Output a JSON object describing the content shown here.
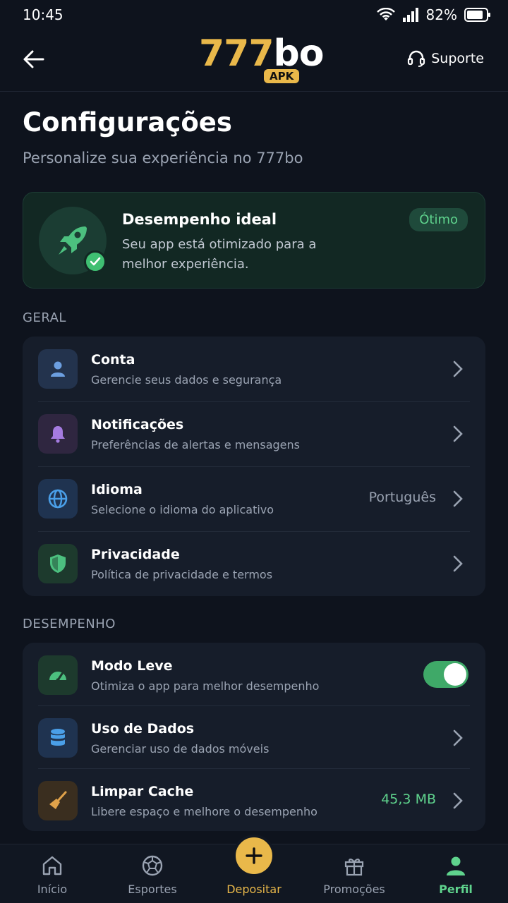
{
  "status_bar": {
    "time": "10:45",
    "battery": "82%"
  },
  "header": {
    "logo_number": "777",
    "logo_suffix": "bo",
    "logo_badge": "APK",
    "support_label": "Suporte"
  },
  "page": {
    "title": "Configurações",
    "subtitle": "Personalize sua experiência no 777bo"
  },
  "performance_card": {
    "title": "Desempenho ideal",
    "description": "Seu app está otimizado para a melhor experiência.",
    "badge": "Ótimo"
  },
  "sections": {
    "general": {
      "label": "GERAL",
      "items": [
        {
          "title": "Conta",
          "subtitle": "Gerencie seus dados e segurança",
          "icon": "user-icon",
          "color": "#5b8fd6"
        },
        {
          "title": "Notificações",
          "subtitle": "Preferências de alertas e mensagens",
          "icon": "bell-icon",
          "color": "#a57be0"
        },
        {
          "title": "Idioma",
          "subtitle": "Selecione o idioma do aplicativo",
          "value": "Português",
          "icon": "globe-icon",
          "color": "#4a9fe8"
        },
        {
          "title": "Privacidade",
          "subtitle": "Política de privacidade e termos",
          "icon": "shield-icon",
          "color": "#4cc07f"
        }
      ]
    },
    "performance": {
      "label": "DESEMPENHO",
      "items": [
        {
          "title": "Modo Leve",
          "subtitle": "Otimiza o app para melhor desempenho",
          "toggle_on": true,
          "icon": "speedometer-icon",
          "color": "#4cc07f"
        },
        {
          "title": "Uso de Dados",
          "subtitle": "Gerenciar uso de dados móveis",
          "icon": "database-icon",
          "color": "#4a9fe8"
        },
        {
          "title": "Limpar Cache",
          "subtitle": "Libere espaço e melhore o desempenho",
          "value": "45,3 MB",
          "icon": "broom-icon",
          "color": "#e0a24a"
        }
      ]
    }
  },
  "bottom_nav": [
    {
      "label": "Início",
      "icon": "home-icon"
    },
    {
      "label": "Esportes",
      "icon": "soccer-ball-icon"
    },
    {
      "label": "Depositar",
      "icon": "plus-icon"
    },
    {
      "label": "Promoções",
      "icon": "gift-icon"
    },
    {
      "label": "Perfil",
      "icon": "person-icon",
      "active": true
    }
  ],
  "colors": {
    "accent_gold": "#e9b84a",
    "accent_green": "#5fd38d",
    "background": "#0e131d",
    "card": "#161d2a"
  }
}
